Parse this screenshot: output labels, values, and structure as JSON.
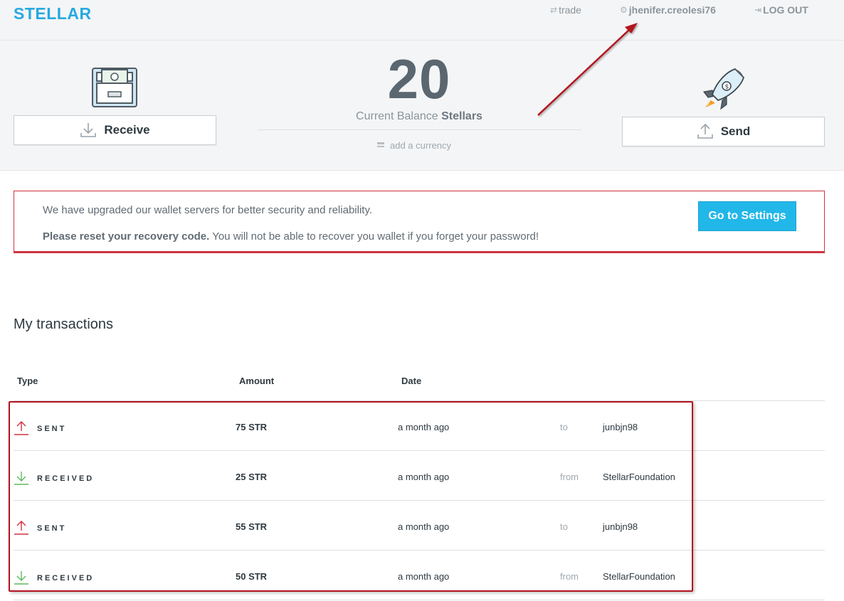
{
  "header": {
    "logo": "STELLAR",
    "trade": "trade",
    "username": "jhenifer.creolesi76",
    "logout": "LOG OUT"
  },
  "balance": {
    "amount": "20",
    "label_prefix": "Current Balance",
    "label_unit": "Stellars",
    "add_currency": "add a currency"
  },
  "actions": {
    "receive": "Receive",
    "send": "Send"
  },
  "notice": {
    "line1": "We have upgraded our wallet servers for better security and reliability.",
    "line2_bold": "Please reset your recovery code.",
    "line2_rest": " You will not be able to recover you wallet if you forget your password!",
    "button": "Go to Settings"
  },
  "transactions": {
    "title": "My transactions",
    "headers": {
      "type": "Type",
      "amount": "Amount",
      "date": "Date"
    },
    "rows": [
      {
        "type": "SENT",
        "amount": "75 STR",
        "date": "a month ago",
        "dir": "to",
        "party": "junbjn98"
      },
      {
        "type": "RECEIVED",
        "amount": "25 STR",
        "date": "a month ago",
        "dir": "from",
        "party": "StellarFoundation"
      },
      {
        "type": "SENT",
        "amount": "55 STR",
        "date": "a month ago",
        "dir": "to",
        "party": "junbjn98"
      },
      {
        "type": "RECEIVED",
        "amount": "50 STR",
        "date": "a month ago",
        "dir": "from",
        "party": "StellarFoundation"
      }
    ]
  },
  "colors": {
    "brand": "#27a9e1",
    "alert": "#d0313f",
    "sent": "#d0313f",
    "received": "#5cb85c",
    "annotation": "#b3121f"
  },
  "icons": {
    "receive": "download-icon",
    "send": "upload-icon",
    "safe": "safe-icon",
    "rocket": "rocket-icon"
  }
}
